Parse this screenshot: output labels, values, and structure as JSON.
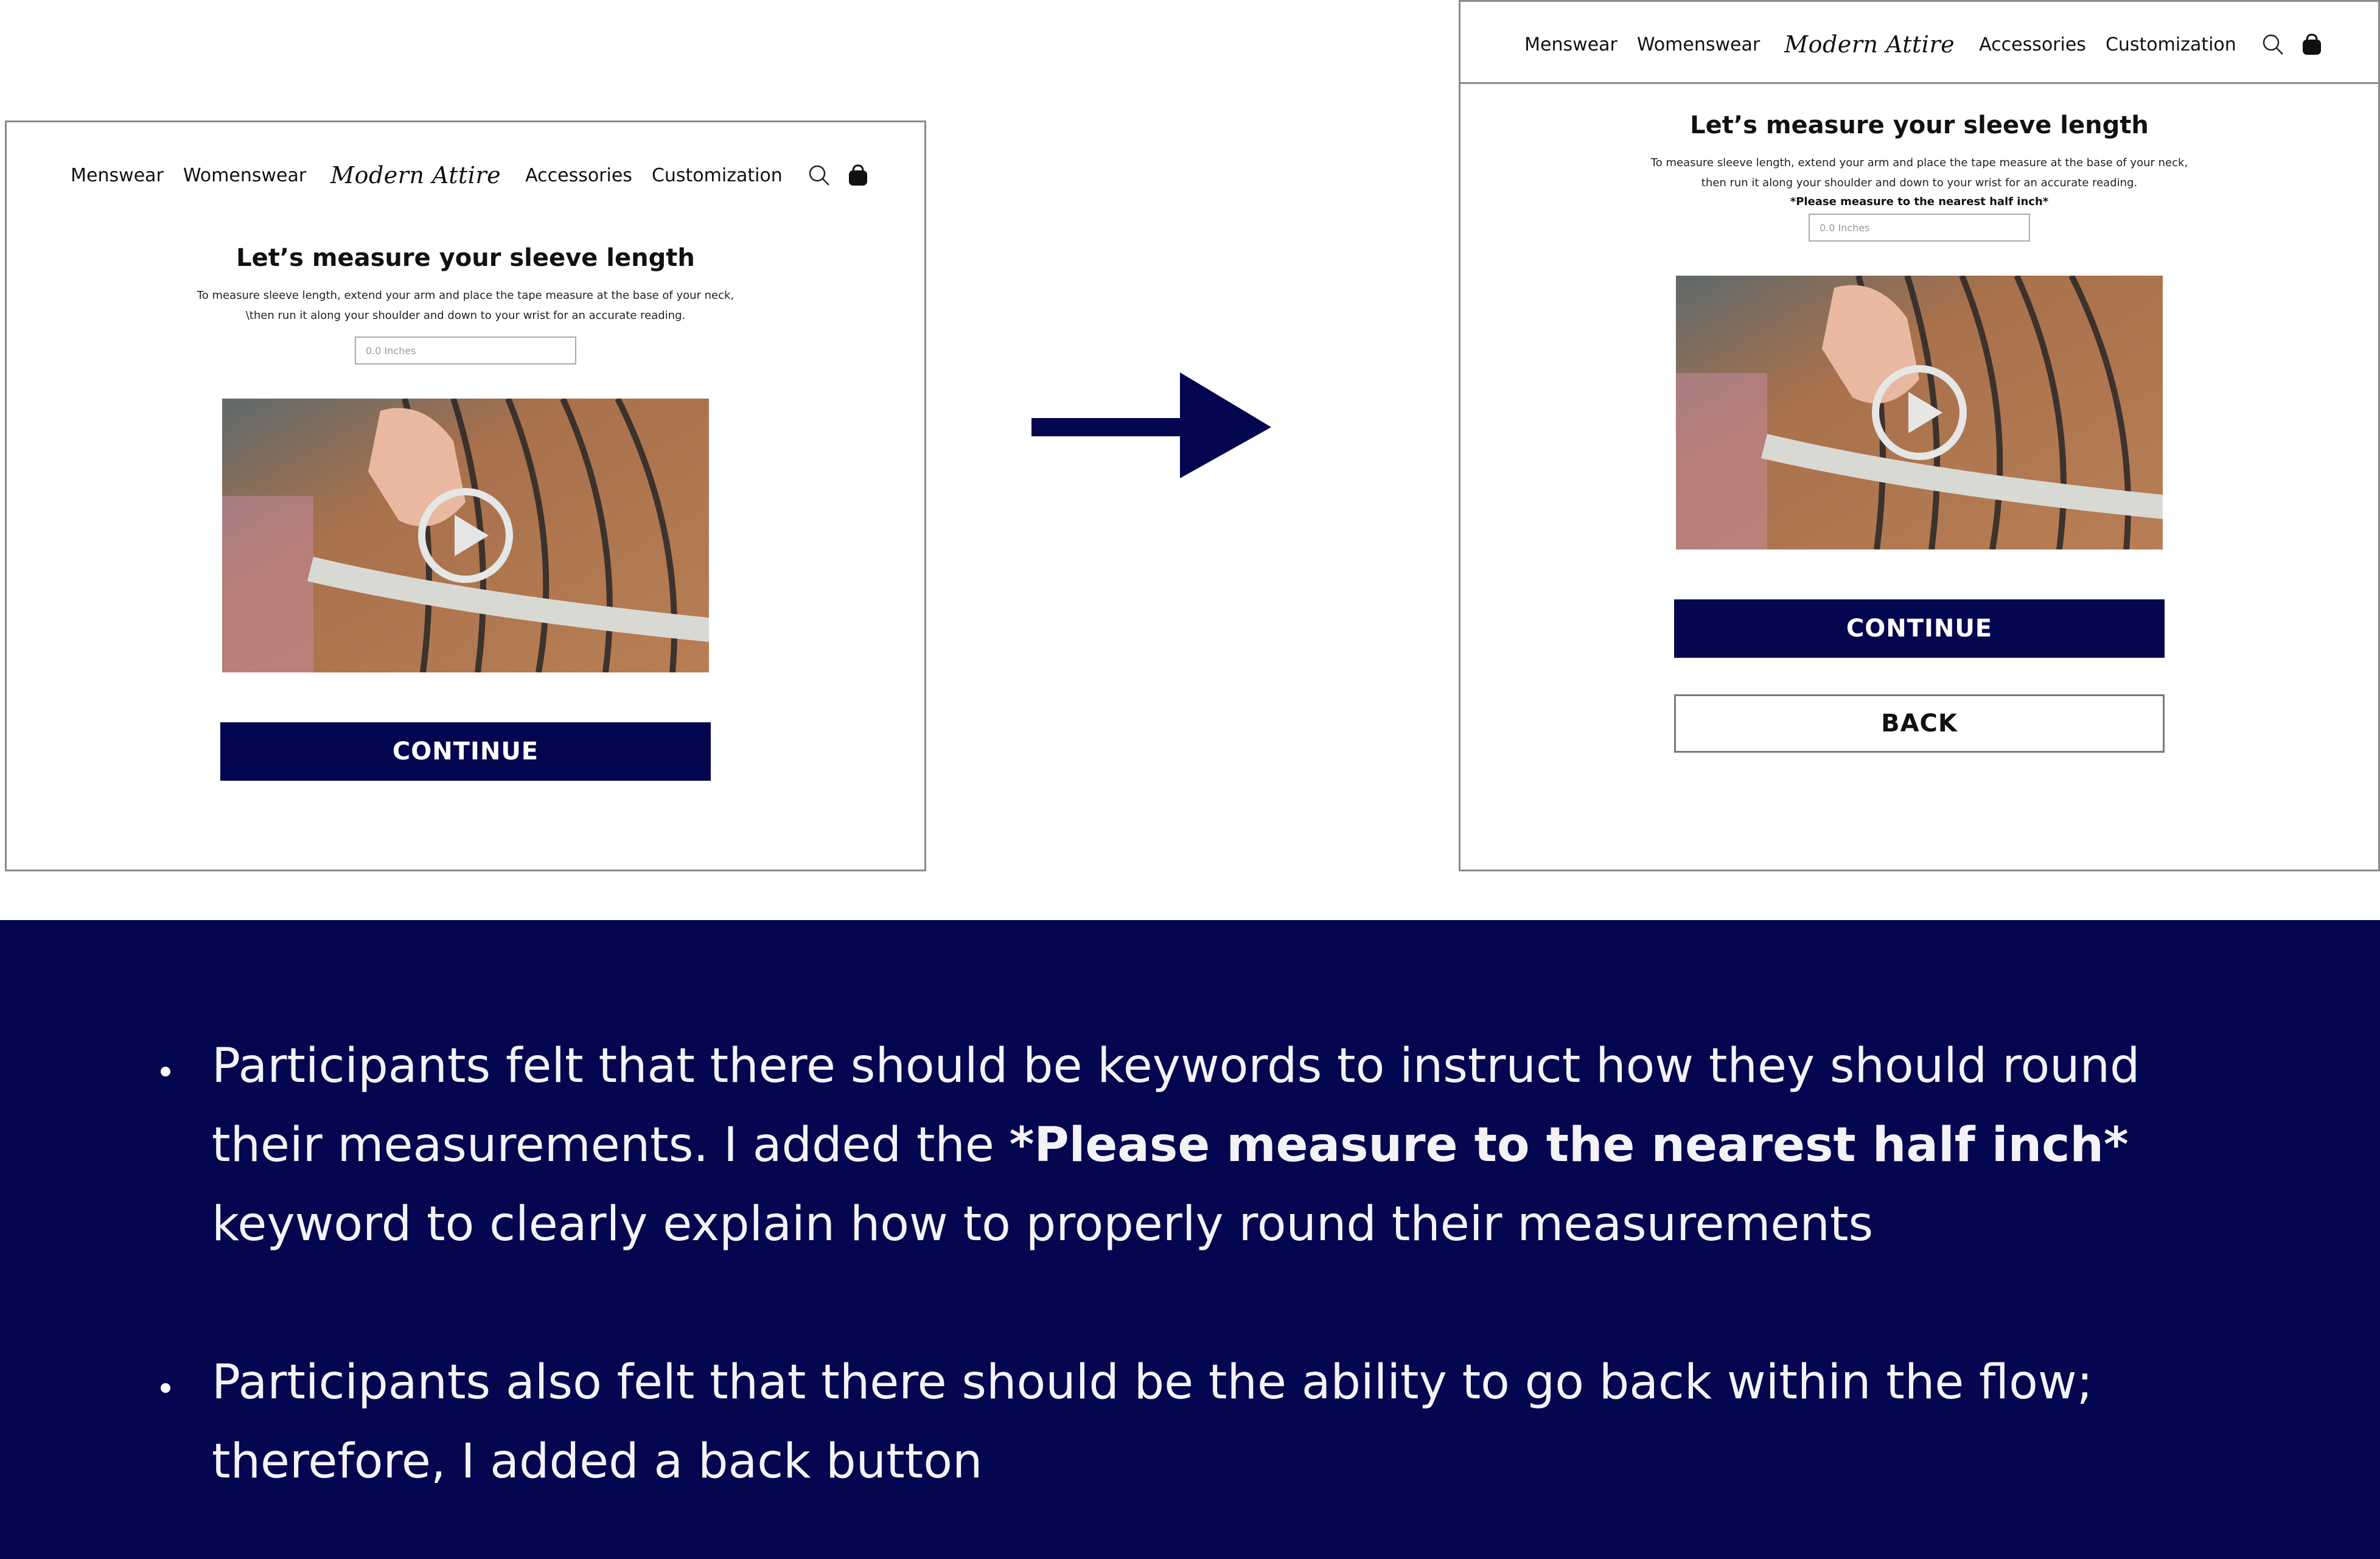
{
  "nav": {
    "menswear": "Menswear",
    "womenswear": "Womenswear",
    "logo": "Modern Attire",
    "accessories": "Accessories",
    "customization": "Customization"
  },
  "before": {
    "title": "Let’s measure your sleeve length",
    "desc_line1": "To measure sleeve length, extend your arm and place the tape measure at the base of your neck,",
    "desc_line2": "\\then run it along your shoulder and down to your wrist for an accurate reading.",
    "input_placeholder": "0.0 Inches",
    "continue_label": "CONTINUE"
  },
  "after": {
    "title": "Let’s measure your sleeve length",
    "desc_line1": "To measure sleeve length, extend your arm and place the tape measure at the base of your neck,",
    "desc_line2": "then run it along your shoulder and down to your wrist for an accurate reading.",
    "note": "*Please measure to the nearest half inch*",
    "input_placeholder": "0.0 Inches",
    "continue_label": "CONTINUE",
    "back_label": "BACK"
  },
  "feedback": {
    "bullet1_part1": "Participants felt that there should be keywords to instruct how they should round their measurements. I added the ",
    "bullet1_bold": "*Please measure to the nearest half inch*",
    "bullet1_part2": "  keyword to clearly explain how to properly round their measurements",
    "bullet2": "Participants also felt that there should be the ability to go back within the flow; therefore, I added a back button"
  },
  "colors": {
    "navy": "#040650",
    "frame_border": "#8a8a8a"
  },
  "icons": [
    "search-icon",
    "shopping-bag-icon",
    "play-icon",
    "arrow-right-icon"
  ]
}
